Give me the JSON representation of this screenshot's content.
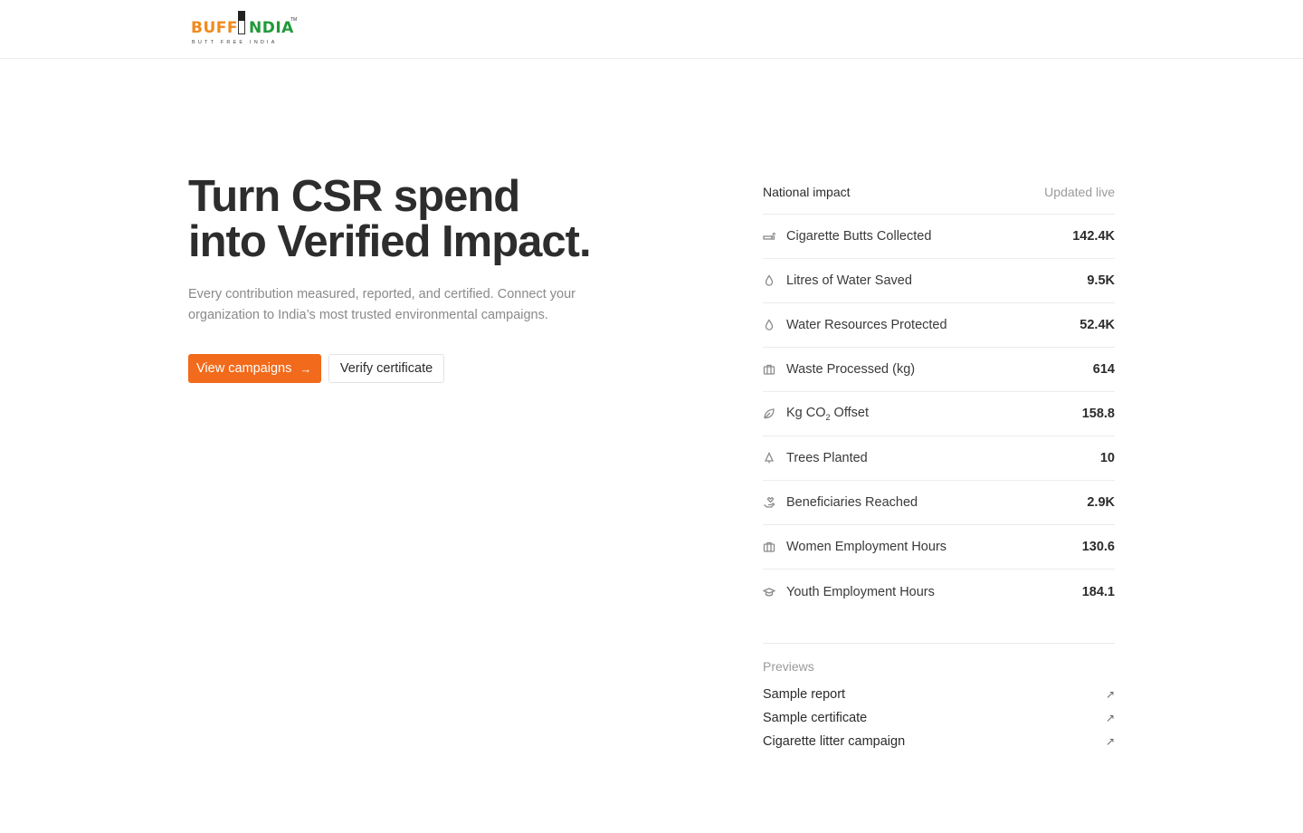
{
  "brand": {
    "word_orange": "BUFF",
    "word_green": "NDIA",
    "trademark": "TM",
    "tagline": "BUTT FREE INDIA",
    "colors": {
      "orange": "#f08a1c",
      "green": "#1f9a3a"
    }
  },
  "hero": {
    "title_line1": "Turn CSR spend",
    "title_line2": "into Verified Impact.",
    "subtitle": "Every contribution measured, reported, and certified. Connect your organization to India’s most trusted environmental campaigns.",
    "primary_button": "View campaigns",
    "primary_arrow": "→",
    "secondary_button": "Verify certificate",
    "accent": "#f26a1b"
  },
  "impact": {
    "title": "National impact",
    "status": "Updated live",
    "metrics": [
      {
        "icon": "cigarette-icon",
        "label": "Cigarette Butts Collected",
        "value": "142.4K"
      },
      {
        "icon": "droplet-icon",
        "label": "Litres of Water Saved",
        "value": "9.5K"
      },
      {
        "icon": "droplet-icon",
        "label": "Water Resources Protected",
        "value": "52.4K"
      },
      {
        "icon": "briefcase-icon",
        "label": "Waste Processed (kg)",
        "value": "614"
      },
      {
        "icon": "leaf-icon",
        "label_pre": "Kg CO",
        "label_sub": "2",
        "label_post": " Offset",
        "value": "158.8"
      },
      {
        "icon": "tree-icon",
        "label": "Trees Planted",
        "value": "10"
      },
      {
        "icon": "hand-heart-icon",
        "label": "Beneficiaries Reached",
        "value": "2.9K"
      },
      {
        "icon": "briefcase-icon",
        "label": "Women Employment Hours",
        "value": "130.6"
      },
      {
        "icon": "graduation-cap-icon",
        "label": "Youth Employment Hours",
        "value": "184.1"
      }
    ]
  },
  "previews": {
    "title": "Previews",
    "links": [
      {
        "label": "Sample report",
        "icon": "↗"
      },
      {
        "label": "Sample certificate",
        "icon": "↗"
      },
      {
        "label": "Cigarette litter campaign",
        "icon": "↗"
      }
    ]
  }
}
